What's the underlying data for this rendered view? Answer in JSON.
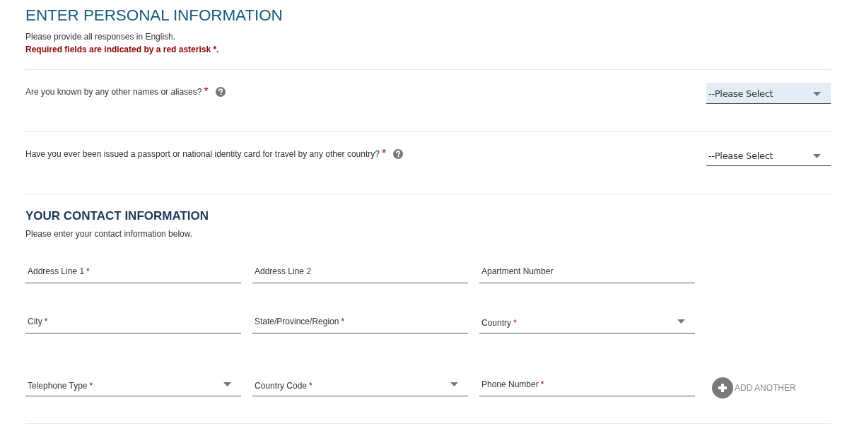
{
  "header": {
    "title": "ENTER PERSONAL INFORMATION",
    "note": "Please provide all responses in English.",
    "required_note": "Required fields are indicated by a red asterisk *."
  },
  "required_mark": "*",
  "questions": [
    {
      "text": "Are you known by any other names or aliases?",
      "required": true,
      "select": {
        "value": "--Please Select",
        "focused": true
      }
    },
    {
      "text": "Have you ever been issued a passport or national identity card for travel by any other country?",
      "required": true,
      "select": {
        "value": "--Please Select",
        "focused": false
      }
    }
  ],
  "contact": {
    "title": "YOUR CONTACT INFORMATION",
    "subtitle": "Please enter your contact information below.",
    "rows": [
      {
        "fields": [
          {
            "kind": "text",
            "label": "Address Line 1",
            "required": true
          },
          {
            "kind": "text",
            "label": "Address Line 2",
            "required": false
          },
          {
            "kind": "text",
            "label": "Apartment Number",
            "required": false
          }
        ]
      },
      {
        "fields": [
          {
            "kind": "text",
            "label": "City",
            "required": true
          },
          {
            "kind": "text",
            "label": "State/Province/Region",
            "required": true
          },
          {
            "kind": "select",
            "label": "Country",
            "required": true
          }
        ]
      },
      {
        "fields": [
          {
            "kind": "select",
            "label": "Telephone Type",
            "required": true
          },
          {
            "kind": "select",
            "label": "Country Code",
            "required": true
          },
          {
            "kind": "text",
            "label": "Phone Number",
            "required": true
          }
        ],
        "action": {
          "label": "ADD ANOTHER"
        }
      }
    ]
  }
}
